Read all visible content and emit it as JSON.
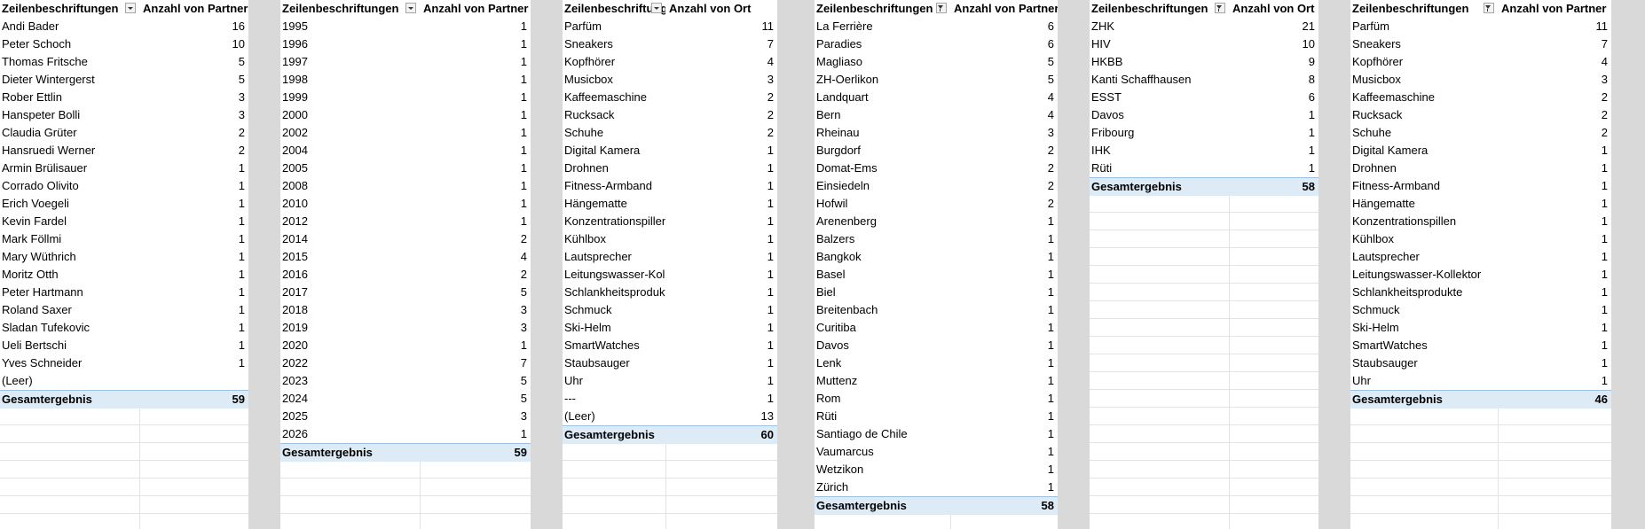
{
  "pivots": [
    {
      "header": {
        "label": "Zeilenbeschriftungen",
        "value": "Anzahl von Partner",
        "filtered": false
      },
      "rows": [
        {
          "label": "Andi Bader",
          "value": "16"
        },
        {
          "label": "Peter Schoch",
          "value": "10"
        },
        {
          "label": "Thomas Fritsche",
          "value": "5"
        },
        {
          "label": "Dieter Wintergerst",
          "value": "5"
        },
        {
          "label": "Rober Ettlin",
          "value": "3"
        },
        {
          "label": "Hanspeter Bolli",
          "value": "3"
        },
        {
          "label": "Claudia Grüter",
          "value": "2"
        },
        {
          "label": "Hansruedi Werner",
          "value": "2"
        },
        {
          "label": "Armin Brülisauer",
          "value": "1"
        },
        {
          "label": "Corrado Olivito",
          "value": "1"
        },
        {
          "label": "Erich Voegeli",
          "value": "1"
        },
        {
          "label": "Kevin Fardel",
          "value": "1"
        },
        {
          "label": "Mark Föllmi",
          "value": "1"
        },
        {
          "label": "Mary Wüthrich",
          "value": "1"
        },
        {
          "label": "Moritz Otth",
          "value": "1"
        },
        {
          "label": "Peter Hartmann",
          "value": "1"
        },
        {
          "label": "Roland Saxer",
          "value": "1"
        },
        {
          "label": "Sladan Tufekovic",
          "value": "1"
        },
        {
          "label": "Ueli Bertschi",
          "value": "1"
        },
        {
          "label": "Yves Schneider",
          "value": "1"
        },
        {
          "label": "(Leer)",
          "value": ""
        }
      ],
      "total": {
        "label": "Gesamtergebnis",
        "value": "59"
      }
    },
    {
      "header": {
        "label": "Zeilenbeschriftungen",
        "value": "Anzahl von Partner",
        "filtered": false
      },
      "rows": [
        {
          "label": "1995",
          "value": "1"
        },
        {
          "label": "1996",
          "value": "1"
        },
        {
          "label": "1997",
          "value": "1"
        },
        {
          "label": "1998",
          "value": "1"
        },
        {
          "label": "1999",
          "value": "1"
        },
        {
          "label": "2000",
          "value": "1"
        },
        {
          "label": "2002",
          "value": "1"
        },
        {
          "label": "2004",
          "value": "1"
        },
        {
          "label": "2005",
          "value": "1"
        },
        {
          "label": "2008",
          "value": "1"
        },
        {
          "label": "2010",
          "value": "1"
        },
        {
          "label": "2012",
          "value": "1"
        },
        {
          "label": "2014",
          "value": "2"
        },
        {
          "label": "2015",
          "value": "4"
        },
        {
          "label": "2016",
          "value": "2"
        },
        {
          "label": "2017",
          "value": "5"
        },
        {
          "label": "2018",
          "value": "3"
        },
        {
          "label": "2019",
          "value": "3"
        },
        {
          "label": "2020",
          "value": "1"
        },
        {
          "label": "2022",
          "value": "7"
        },
        {
          "label": "2023",
          "value": "5"
        },
        {
          "label": "2024",
          "value": "5"
        },
        {
          "label": "2025",
          "value": "3"
        },
        {
          "label": "2026",
          "value": "1"
        }
      ],
      "total": {
        "label": "Gesamtergebnis",
        "value": "59"
      }
    },
    {
      "header": {
        "label": "Zeilenbeschriftungen",
        "value": "Anzahl von Ort",
        "filtered": false
      },
      "rows": [
        {
          "label": "Parfüm",
          "value": "11"
        },
        {
          "label": "Sneakers",
          "value": "7"
        },
        {
          "label": "Kopfhörer",
          "value": "4"
        },
        {
          "label": "Musicbox",
          "value": "3"
        },
        {
          "label": "Kaffeemaschine",
          "value": "2"
        },
        {
          "label": "Rucksack",
          "value": "2"
        },
        {
          "label": "Schuhe",
          "value": "2"
        },
        {
          "label": "Digital Kamera",
          "value": "1"
        },
        {
          "label": "Drohnen",
          "value": "1"
        },
        {
          "label": "Fitness-Armband",
          "value": "1"
        },
        {
          "label": "Hängematte",
          "value": "1"
        },
        {
          "label": "Konzentrationspillen",
          "value": "1"
        },
        {
          "label": "Kühlbox",
          "value": "1"
        },
        {
          "label": "Lautsprecher",
          "value": "1"
        },
        {
          "label": "Leitungswasser-Kollektor",
          "value": "1"
        },
        {
          "label": "Schlankheitsprodukte",
          "value": "1"
        },
        {
          "label": "Schmuck",
          "value": "1"
        },
        {
          "label": "Ski-Helm",
          "value": "1"
        },
        {
          "label": "SmartWatches",
          "value": "1"
        },
        {
          "label": "Staubsauger",
          "value": "1"
        },
        {
          "label": "Uhr",
          "value": "1"
        },
        {
          "label": "---",
          "value": "1"
        },
        {
          "label": "(Leer)",
          "value": "13"
        }
      ],
      "total": {
        "label": "Gesamtergebnis",
        "value": "60"
      }
    },
    {
      "header": {
        "label": "Zeilenbeschriftungen",
        "value": "Anzahl von Partner",
        "filtered": true
      },
      "rows": [
        {
          "label": "La Ferrière",
          "value": "6"
        },
        {
          "label": "Paradies",
          "value": "6"
        },
        {
          "label": "Magliaso",
          "value": "5"
        },
        {
          "label": "ZH-Oerlikon",
          "value": "5"
        },
        {
          "label": "Landquart",
          "value": "4"
        },
        {
          "label": "Bern",
          "value": "4"
        },
        {
          "label": "Rheinau",
          "value": "3"
        },
        {
          "label": "Burgdorf",
          "value": "2"
        },
        {
          "label": "Domat-Ems",
          "value": "2"
        },
        {
          "label": "Einsiedeln",
          "value": "2"
        },
        {
          "label": "Hofwil",
          "value": "2"
        },
        {
          "label": "Arenenberg",
          "value": "1"
        },
        {
          "label": "Balzers",
          "value": "1"
        },
        {
          "label": "Bangkok",
          "value": "1"
        },
        {
          "label": "Basel",
          "value": "1"
        },
        {
          "label": "Biel",
          "value": "1"
        },
        {
          "label": "Breitenbach",
          "value": "1"
        },
        {
          "label": "Curitiba",
          "value": "1"
        },
        {
          "label": "Davos",
          "value": "1"
        },
        {
          "label": "Lenk",
          "value": "1"
        },
        {
          "label": "Muttenz",
          "value": "1"
        },
        {
          "label": "Rom",
          "value": "1"
        },
        {
          "label": "Rüti",
          "value": "1"
        },
        {
          "label": "Santiago de Chile",
          "value": "1"
        },
        {
          "label": "Vaumarcus",
          "value": "1"
        },
        {
          "label": "Wetzikon",
          "value": "1"
        },
        {
          "label": "Zürich",
          "value": "1"
        }
      ],
      "total": {
        "label": "Gesamtergebnis",
        "value": "58"
      }
    },
    {
      "header": {
        "label": "Zeilenbeschriftungen",
        "value": "Anzahl von Ort",
        "filtered": true
      },
      "rows": [
        {
          "label": "ZHK",
          "value": "21"
        },
        {
          "label": "HIV",
          "value": "10"
        },
        {
          "label": "HKBB",
          "value": "9"
        },
        {
          "label": "Kanti Schaffhausen",
          "value": "8"
        },
        {
          "label": "ESST",
          "value": "6"
        },
        {
          "label": "Davos",
          "value": "1"
        },
        {
          "label": "Fribourg",
          "value": "1"
        },
        {
          "label": "IHK",
          "value": "1"
        },
        {
          "label": "Rüti",
          "value": "1"
        }
      ],
      "total": {
        "label": "Gesamtergebnis",
        "value": "58"
      }
    },
    {
      "header": {
        "label": "Zeilenbeschriftungen",
        "value": "Anzahl von Partner",
        "filtered": true
      },
      "rows": [
        {
          "label": "Parfüm",
          "value": "11"
        },
        {
          "label": "Sneakers",
          "value": "7"
        },
        {
          "label": "Kopfhörer",
          "value": "4"
        },
        {
          "label": "Musicbox",
          "value": "3"
        },
        {
          "label": "Kaffeemaschine",
          "value": "2"
        },
        {
          "label": "Rucksack",
          "value": "2"
        },
        {
          "label": "Schuhe",
          "value": "2"
        },
        {
          "label": "Digital Kamera",
          "value": "1"
        },
        {
          "label": "Drohnen",
          "value": "1"
        },
        {
          "label": "Fitness-Armband",
          "value": "1"
        },
        {
          "label": "Hängematte",
          "value": "1"
        },
        {
          "label": "Konzentrationspillen",
          "value": "1"
        },
        {
          "label": "Kühlbox",
          "value": "1"
        },
        {
          "label": "Lautsprecher",
          "value": "1"
        },
        {
          "label": "Leitungswasser-Kollektor",
          "value": "1"
        },
        {
          "label": "Schlankheitsprodukte",
          "value": "1"
        },
        {
          "label": "Schmuck",
          "value": "1"
        },
        {
          "label": "Ski-Helm",
          "value": "1"
        },
        {
          "label": "SmartWatches",
          "value": "1"
        },
        {
          "label": "Staubsauger",
          "value": "1"
        },
        {
          "label": "Uhr",
          "value": "1"
        }
      ],
      "total": {
        "label": "Gesamtergebnis",
        "value": "46"
      }
    }
  ]
}
